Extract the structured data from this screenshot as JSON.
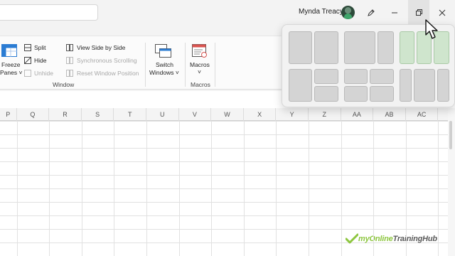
{
  "titlebar": {
    "user_name": "Mynda Treacy",
    "icons": [
      "search-box",
      "avatar",
      "pen-icon",
      "minimize-icon",
      "restore-icon",
      "close-icon"
    ]
  },
  "ribbon": {
    "freeze_panes": {
      "line1": "Freeze",
      "line2": "Panes ˅"
    },
    "split": "Split",
    "hide": "Hide",
    "unhide": "Unhide",
    "view_side_by_side": "View Side by Side",
    "synchronous_scrolling": "Synchronous Scrolling",
    "reset_window_position": "Reset Window Position",
    "switch_windows": {
      "line1": "Switch",
      "line2": "Windows ˅"
    },
    "macros": {
      "line1": "Macros",
      "line2": "˅"
    },
    "groups": {
      "window": "Window",
      "macros": "Macros"
    }
  },
  "columns": [
    "P",
    "Q",
    "R",
    "S",
    "T",
    "U",
    "V",
    "W",
    "X",
    "Y",
    "Z",
    "AA",
    "AB",
    "AC"
  ],
  "snap": {
    "layouts": [
      "two-equal",
      "two-wide-narrow",
      "three-columns",
      "left-and-two-stacked",
      "four-quadrants",
      "three-narrow-columns"
    ],
    "hovered_layout": "three-columns"
  },
  "watermark": {
    "brand_green": "myOnline",
    "brand_dark": "TrainingHub"
  },
  "colors": {
    "accent_green": "#8dc63f",
    "snap_hover": "#cfe5cd",
    "zone": "#d4d4d4"
  }
}
